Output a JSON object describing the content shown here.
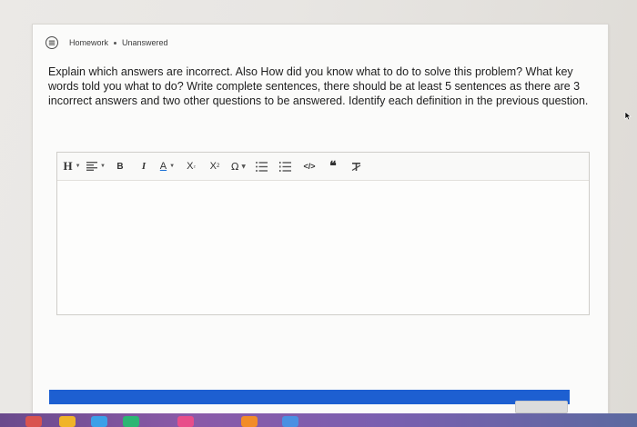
{
  "header": {
    "section": "Homework",
    "status": "Unanswered"
  },
  "question": {
    "text": "Explain which answers are incorrect. Also How did you know what to do to solve this problem? What key words told you what to do? Write complete sentences, there should be at least 5 sentences as there are 3 incorrect answers and two other questions to be answered. Identify each definition in the previous question."
  },
  "toolbar": {
    "heading": "H",
    "bold": "B",
    "italic": "I",
    "font_color": "A",
    "subscript": "X",
    "superscript": "X",
    "special_char": "Ω",
    "code": "</>",
    "quote": "66",
    "clear_format": "T̶"
  },
  "colors": {
    "accent_bar": "#1d5fd1",
    "card_bg": "#fbfbfa"
  }
}
